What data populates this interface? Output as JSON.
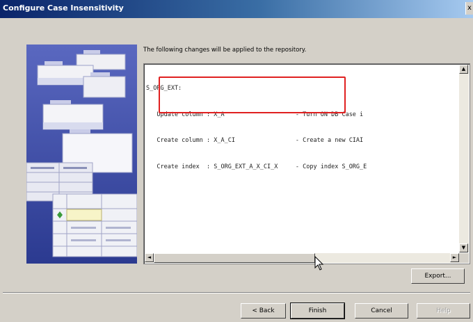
{
  "window": {
    "title": "Configure Case Insensitivity",
    "close_label": "x"
  },
  "intro": "The following changes will be applied to the repository.",
  "code_lines": [
    "S_ORG_EXT:",
    "   Update column : X_A                    - Turn ON DB Case i",
    "   Create column : X_A_CI                 - Create a new CIAI",
    "   Create index  : S_ORG_EXT_A_X_CI_X     - Copy index S_ORG_E"
  ],
  "buttons": {
    "export": "Export...",
    "back": "< Back",
    "finish": "Finish",
    "cancel": "Cancel",
    "help": "Help"
  },
  "scroll": {
    "up": "▲",
    "down": "▼",
    "left": "◄",
    "right": "►"
  },
  "icons": {
    "close": "close-icon",
    "illustration": "folders-and-tables-illustration",
    "cursor": "mouse-pointer-icon"
  },
  "colors": {
    "titlebar_start": "#0a246a",
    "titlebar_end": "#a6caf0",
    "dialog_bg": "#d4d0c8",
    "illustration_bg": "#3d50a8",
    "highlight": "#e02020"
  }
}
